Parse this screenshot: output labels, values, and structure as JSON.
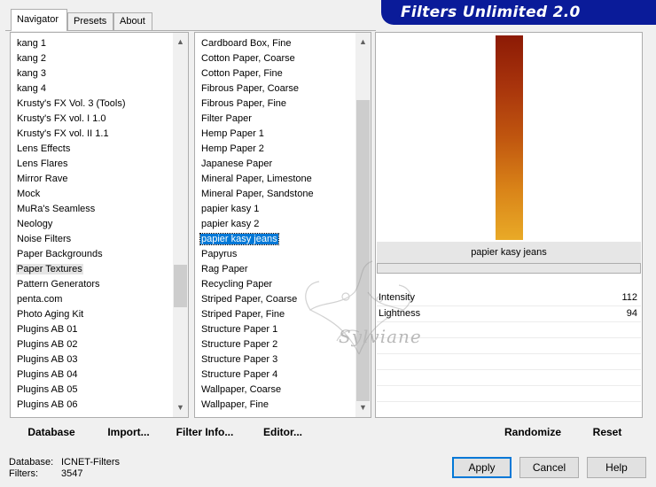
{
  "banner": {
    "title": "Filters Unlimited 2.0"
  },
  "tabs": [
    {
      "label": "Navigator",
      "active": true
    },
    {
      "label": "Presets",
      "active": false
    },
    {
      "label": "About",
      "active": false
    }
  ],
  "categories": {
    "items": [
      "kang 1",
      "kang 2",
      "kang 3",
      "kang 4",
      "Krusty's FX Vol. 3 (Tools)",
      "Krusty's FX vol. I 1.0",
      "Krusty's FX vol. II 1.1",
      "Lens Effects",
      "Lens Flares",
      "Mirror Rave",
      "Mock",
      "MuRa's Seamless",
      "Neology",
      "Noise Filters",
      "Paper Backgrounds",
      "Paper Textures",
      "Pattern Generators",
      "penta.com",
      "Photo Aging Kit",
      "Plugins AB 01",
      "Plugins AB 02",
      "Plugins AB 03",
      "Plugins AB 04",
      "Plugins AB 05",
      "Plugins AB 06"
    ],
    "selected": "Paper Textures"
  },
  "filters": {
    "items": [
      "Cardboard Box, Fine",
      "Cotton Paper, Coarse",
      "Cotton Paper, Fine",
      "Fibrous Paper, Coarse",
      "Fibrous Paper, Fine",
      "Filter Paper",
      "Hemp Paper 1",
      "Hemp Paper 2",
      "Japanese Paper",
      "Mineral Paper, Limestone",
      "Mineral Paper, Sandstone",
      "papier kasy 1",
      "papier kasy 2",
      "papier kasy jeans",
      "Papyrus",
      "Rag Paper",
      "Recycling Paper",
      "Striped Paper, Coarse",
      "Striped Paper, Fine",
      "Structure Paper 1",
      "Structure Paper 2",
      "Structure Paper 3",
      "Structure Paper 4",
      "Wallpaper, Coarse",
      "Wallpaper, Fine"
    ],
    "selected": "papier kasy jeans"
  },
  "preview": {
    "filter_name": "papier kasy jeans",
    "params": [
      {
        "label": "Intensity",
        "value": "112"
      },
      {
        "label": "Lightness",
        "value": "94"
      }
    ]
  },
  "toolbar": {
    "database": "Database",
    "import": "Import...",
    "filter_info": "Filter Info...",
    "editor": "Editor...",
    "randomize": "Randomize",
    "reset": "Reset"
  },
  "status": {
    "database_label": "Database:",
    "database_value": "ICNET-Filters",
    "filters_label": "Filters:",
    "filters_value": "3547"
  },
  "buttons": {
    "apply": "Apply",
    "cancel": "Cancel",
    "help": "Help"
  },
  "watermark": {
    "text": "Sylviane"
  },
  "colors": {
    "banner": "#0a1b99",
    "selection": "#0078d7",
    "preview_top": "#8c1a05",
    "preview_bottom": "#e9aa27"
  }
}
